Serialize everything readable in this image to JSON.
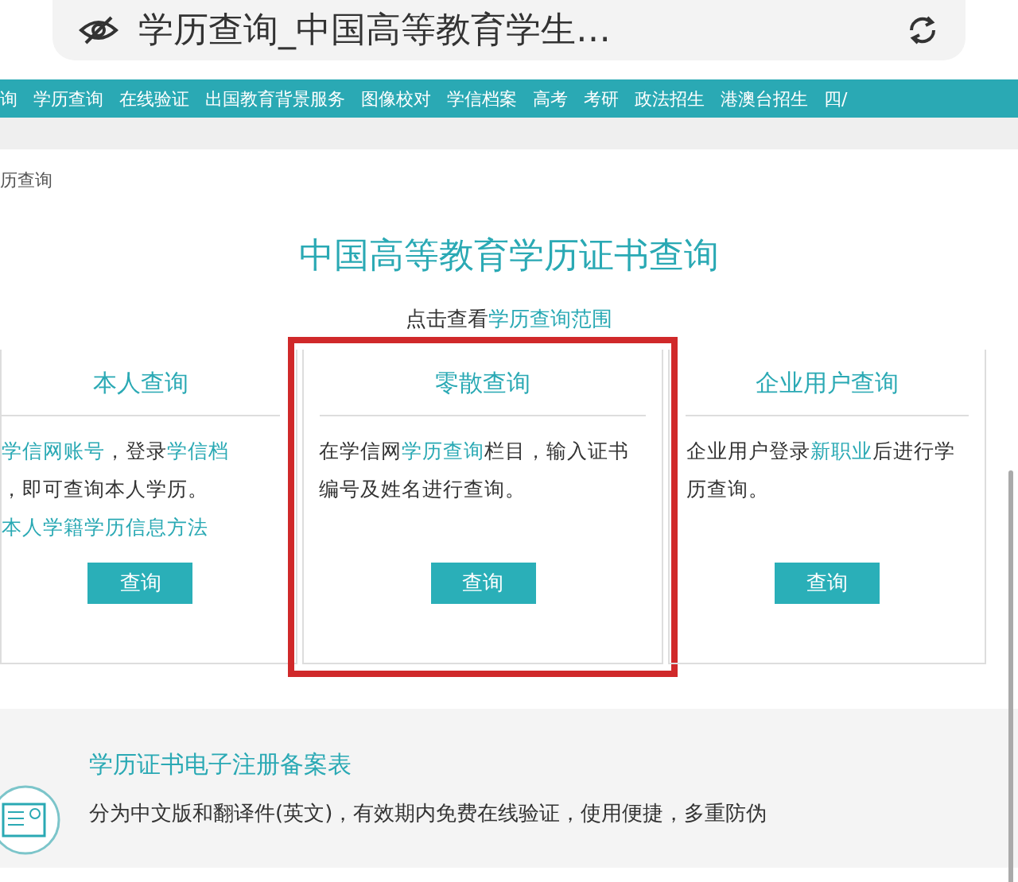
{
  "address_bar": {
    "title": "学历查询_中国高等教育学生…"
  },
  "nav": {
    "items": [
      "询",
      "学历查询",
      "在线验证",
      "出国教育背景服务",
      "图像校对",
      "学信档案",
      "高考",
      "考研",
      "政法招生",
      "港澳台招生",
      "四/"
    ]
  },
  "breadcrumb": "历查询",
  "heading": "中国高等教育学历证书查询",
  "scope_line": "点击查看**学历查询范围**",
  "cards": [
    {
      "title": "本人查询",
      "lines": [
        "**学信网账号**，登录**学信档**",
        "，即可查询本人学历。"
      ],
      "link": "本人学籍学历信息方法",
      "button": "查询",
      "highlighted": false
    },
    {
      "title": "零散查询",
      "lines": [
        "在学信网**学历查询**栏目，输入证书编号及姓名进行查询。"
      ],
      "button": "查询",
      "highlighted": true
    },
    {
      "title": "企业用户查询",
      "lines": [
        "企业用户登录**新职业**后进行学历查询。"
      ],
      "button": "查询",
      "highlighted": false
    }
  ],
  "feature": {
    "title": "学历证书电子注册备案表",
    "description": "分为中文版和翻译件(英文)，有效期内免费在线验证，使用便捷，多重防伪"
  }
}
